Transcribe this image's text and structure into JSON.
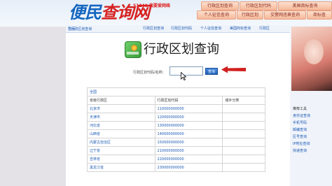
{
  "header": {
    "logo_prefix": "便民",
    "logo_suffix": "查询网",
    "slogan": "51240 我要爱网络",
    "nav_row1": [
      "行政区划查询",
      "行政区划代码",
      "美国商标查询"
    ],
    "nav_row2": [
      "个人征信查询",
      "行政区划",
      "交警网违章查询",
      "商标查"
    ]
  },
  "breadcrumb": {
    "home": "首页",
    "current": "行政区划查询",
    "quick_links": [
      "行政区划查询",
      "行政区划代码",
      "个人征信查询",
      "美国商标查询",
      "行政区"
    ]
  },
  "page": {
    "title": "行政区划查询",
    "search_label": "行政区划代码/名称：",
    "search_value": "",
    "search_button": "查询"
  },
  "table": {
    "top_link": "全国",
    "headers": [
      "省级行政区",
      "行政区划代码",
      "城乡分类"
    ],
    "rows": [
      {
        "name": "北京市",
        "code": "110000000000",
        "type": ""
      },
      {
        "name": "天津市",
        "code": "120000000000",
        "type": ""
      },
      {
        "name": "河北省",
        "code": "130000000000",
        "type": ""
      },
      {
        "name": "山西省",
        "code": "140000000000",
        "type": ""
      },
      {
        "name": "内蒙古自治区",
        "code": "150000000000",
        "type": ""
      },
      {
        "name": "辽宁省",
        "code": "210000000000",
        "type": ""
      },
      {
        "name": "吉林省",
        "code": "220000000000",
        "type": ""
      },
      {
        "name": "黑龙江省",
        "code": "230000000000",
        "type": ""
      }
    ]
  },
  "right_panel": {
    "title": "推荐工具",
    "links": [
      "身份证查询",
      "手机号码",
      "邮编查询",
      "区号查询",
      "IP地址查询",
      "快递查询"
    ]
  }
}
